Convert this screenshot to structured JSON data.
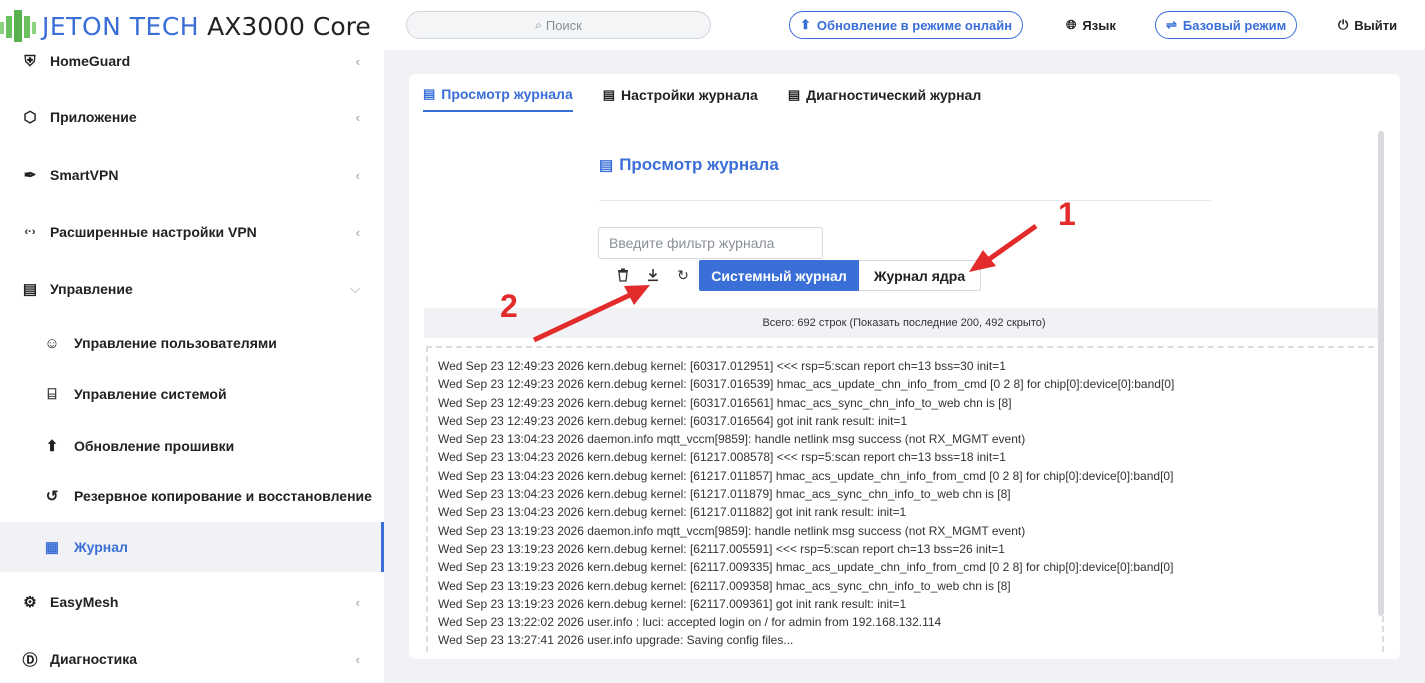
{
  "header": {
    "brand": "JETON TECH",
    "model": "AX3000 Core",
    "search_placeholder": "Поиск",
    "online_update": "Обновление в режиме онлайн",
    "language": "Язык",
    "basic_mode": "Базовый режим",
    "logout": "Выйти"
  },
  "sidebar": {
    "items": [
      {
        "label": "HomeGuard",
        "icon": "shield-icon"
      },
      {
        "label": "Приложение",
        "icon": "cube-icon"
      },
      {
        "label": "SmartVPN",
        "icon": "plug-icon"
      },
      {
        "label": "Расширенные настройки VPN",
        "icon": "code-icon"
      },
      {
        "label": "Управление",
        "icon": "toolbox-icon"
      },
      {
        "label": "Управление пользователями",
        "icon": "user-icon"
      },
      {
        "label": "Управление системой",
        "icon": "system-icon"
      },
      {
        "label": "Обновление прошивки",
        "icon": "upgrade-icon"
      },
      {
        "label": "Резервное копирование и восстановление",
        "icon": "restore-icon"
      },
      {
        "label": "Журнал",
        "icon": "log-icon"
      },
      {
        "label": "EasyMesh",
        "icon": "mesh-icon"
      },
      {
        "label": "Диагностика",
        "icon": "diagnostics-icon"
      }
    ]
  },
  "tabs": [
    "Просмотр журнала",
    "Настройки журнала",
    "Диагностический журнал"
  ],
  "panel": {
    "title": "Просмотр журнала",
    "filter_placeholder": "Введите фильтр журнала",
    "system_log": "Системный журнал",
    "kernel_log": "Журнал ядра",
    "total": "Всего: 692 строк (Показать последние 200, 492 скрыто)"
  },
  "log_lines": [
    "Wed Sep 23 12:49:23 2026 kern.debug kernel: [60317.012951] <<< rsp=5:scan report ch=13 bss=30 init=1",
    "Wed Sep 23 12:49:23 2026 kern.debug kernel: [60317.016539] hmac_acs_update_chn_info_from_cmd [0 2 8] for chip[0]:device[0]:band[0]",
    "Wed Sep 23 12:49:23 2026 kern.debug kernel: [60317.016561] hmac_acs_sync_chn_info_to_web chn is [8]",
    "Wed Sep 23 12:49:23 2026 kern.debug kernel: [60317.016564] got init rank result: init=1",
    "Wed Sep 23 13:04:23 2026 daemon.info mqtt_vccm[9859]: handle netlink msg success (not RX_MGMT event)",
    "Wed Sep 23 13:04:23 2026 kern.debug kernel: [61217.008578] <<< rsp=5:scan report ch=13 bss=18 init=1",
    "Wed Sep 23 13:04:23 2026 kern.debug kernel: [61217.011857] hmac_acs_update_chn_info_from_cmd [0 2 8] for chip[0]:device[0]:band[0]",
    "Wed Sep 23 13:04:23 2026 kern.debug kernel: [61217.011879] hmac_acs_sync_chn_info_to_web chn is [8]",
    "Wed Sep 23 13:04:23 2026 kern.debug kernel: [61217.011882] got init rank result: init=1",
    "Wed Sep 23 13:19:23 2026 daemon.info mqtt_vccm[9859]: handle netlink msg success (not RX_MGMT event)",
    "Wed Sep 23 13:19:23 2026 kern.debug kernel: [62117.005591] <<< rsp=5:scan report ch=13 bss=26 init=1",
    "Wed Sep 23 13:19:23 2026 kern.debug kernel: [62117.009335] hmac_acs_update_chn_info_from_cmd [0 2 8] for chip[0]:device[0]:band[0]",
    "Wed Sep 23 13:19:23 2026 kern.debug kernel: [62117.009358] hmac_acs_sync_chn_info_to_web chn is [8]",
    "Wed Sep 23 13:19:23 2026 kern.debug kernel: [62117.009361] got init rank result: init=1",
    "Wed Sep 23 13:22:02 2026 user.info : luci: accepted login on / for admin from 192.168.132.114",
    "Wed Sep 23 13:27:41 2026 user.info upgrade: Saving config files..."
  ],
  "annotations": {
    "label_1": "1",
    "label_2": "2",
    "color": "#e32b2b"
  },
  "colors": {
    "accent": "#3b6fd8"
  }
}
